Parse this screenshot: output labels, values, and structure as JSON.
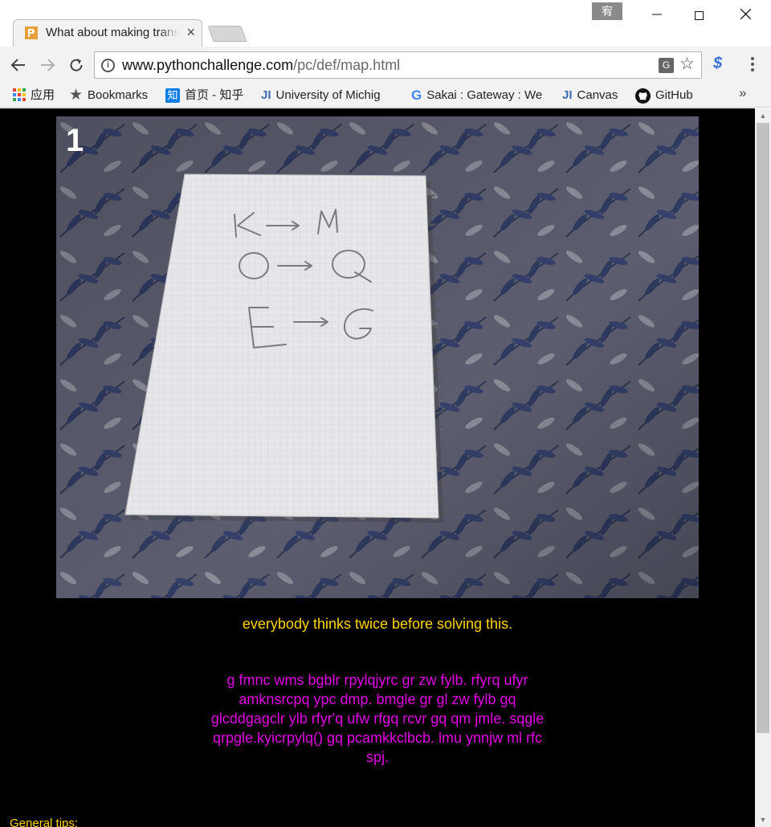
{
  "browser": {
    "tab": {
      "title": "What about making trans",
      "close": "×"
    },
    "ime_badge": "宥",
    "window_controls": {
      "minimize": "—",
      "close": "✕"
    },
    "url": {
      "host": "www.pythonchallenge.com",
      "path": "/pc/def/map.html"
    },
    "bookmarks": [
      {
        "label": "应用",
        "icon": "apps-grid-icon"
      },
      {
        "label": "Bookmarks",
        "icon": "star-icon"
      },
      {
        "label": "首页 - 知乎",
        "icon": "zhihu-icon",
        "icon_text": "知"
      },
      {
        "label": "University of Michig",
        "icon": "ji-icon",
        "icon_text": "JI"
      },
      {
        "label": "Sakai : Gateway : We",
        "icon": "google-icon",
        "icon_text": "G"
      },
      {
        "label": "Canvas",
        "icon": "ji-icon",
        "icon_text": "JI"
      },
      {
        "label": "GitHub",
        "icon": "github-icon"
      }
    ],
    "bookmarks_overflow": "»"
  },
  "page": {
    "background": "#000000",
    "image": {
      "frame_number": "1",
      "notebook_text": [
        "K → M",
        "O → Q",
        "E → G"
      ]
    },
    "caption": "everybody thinks twice before solving this.",
    "caption_color": "#ffd400",
    "cipher_text": "g fmnc wms bgblr rpylqjyrc gr zw fylb. rfyrq ufyr amknsrcpq ypc dmp. bmgle gr gl zw fylb gq glcddgagclr ylb rfyr'q ufw rfgq rcvr gq qm jmle. sqgle qrpgle.kyicrpylq() gq pcamkkclbcb. lmu ynnjw ml rfc spj.",
    "cipher_color": "#e400e4",
    "tips": "General tips:"
  }
}
